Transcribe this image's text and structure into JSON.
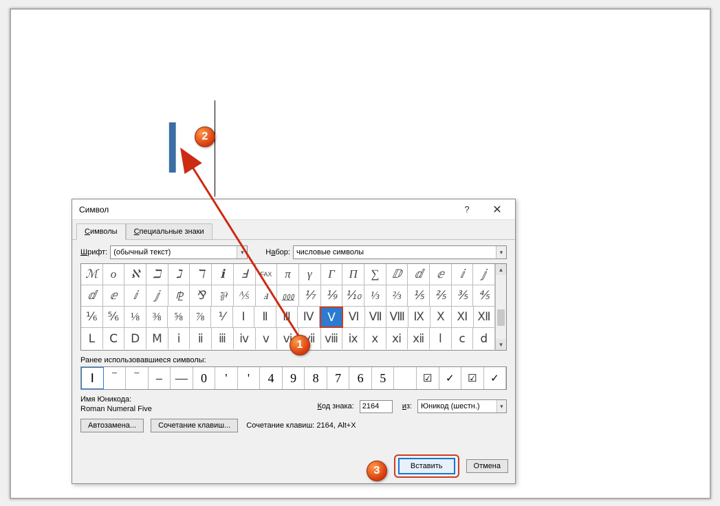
{
  "document": {
    "inserted_char": "Ⅰ"
  },
  "dialog": {
    "title": "Символ",
    "help": "?",
    "tabs": {
      "symbols_pre": "С",
      "symbols": "имволы",
      "special_pre": "С",
      "special": "пециальные знаки"
    },
    "font_label_pre": "Ш",
    "font_label": "рифт:",
    "font_value": "(обычный текст)",
    "subset_label_pre": "Н",
    "subset_label_mid": "а",
    "subset_label": "бор:",
    "subset_value": "числовые символы",
    "grid": {
      "row1": [
        "ℳ",
        "o",
        "ℵ",
        "ℶ",
        "ℷ",
        "ℸ",
        "ℹ",
        "Ⅎ",
        "FAX",
        "π",
        "γ",
        "Γ",
        "Π",
        "∑",
        "ⅅ",
        "ⅆ",
        "ⅇ",
        "ⅈ",
        "ⅉ"
      ],
      "row2": [
        "ⅆ",
        "ⅇ",
        "ⅈ",
        "ⅉ",
        "⅊",
        "⅋",
        "⅌",
        "⅍",
        "ⅎ",
        "⅏",
        "⅐",
        "⅑",
        "⅒",
        "⅓",
        "⅔",
        "⅕",
        "⅖",
        "⅗",
        "⅘"
      ],
      "row3": [
        "⅙",
        "⅚",
        "⅛",
        "⅜",
        "⅝",
        "⅞",
        "⅟",
        "Ⅰ",
        "Ⅱ",
        "Ⅲ",
        "Ⅳ",
        "Ⅴ",
        "Ⅵ",
        "Ⅶ",
        "Ⅷ",
        "Ⅸ",
        "Ⅹ",
        "Ⅺ",
        "Ⅻ"
      ],
      "row4": [
        "Ⅼ",
        "Ⅽ",
        "Ⅾ",
        "Ⅿ",
        "ⅰ",
        "ⅱ",
        "ⅲ",
        "ⅳ",
        "ⅴ",
        "ⅵ",
        "ⅶ",
        "ⅷ",
        "ⅸ",
        "ⅹ",
        "ⅺ",
        "ⅻ",
        "ⅼ",
        "ⅽ",
        "ⅾ"
      ],
      "selected_index": 11
    },
    "recent_label": "Ранее использовавшиеся символы:",
    "recent": [
      "Ⅰ",
      "‾",
      "‾",
      "–",
      "—",
      "0",
      "'",
      "'",
      "4",
      "9",
      "8",
      "7",
      "6",
      "5",
      "",
      "☑",
      "✓",
      "☑",
      "✓"
    ],
    "unicode_label": "Имя Юникода:",
    "unicode_name": "Roman Numeral Five",
    "code_label_pre": "К",
    "code_label": "од знака:",
    "code_value": "2164",
    "from_label_pre": "и",
    "from_label": "з:",
    "from_value": "Юникод (шестн.)",
    "autocorrect_pre": "А",
    "autocorrect": "втозамена...",
    "shortcut_btn": "Сочетани",
    "shortcut_btn_ul": "е",
    "shortcut_btn_post": " клавиш...",
    "shortcut_text": "Сочетание клавиш: 2164, Alt+X",
    "insert_pre": "Вст",
    "insert_ul": "а",
    "insert_post": "вить",
    "cancel": "Отмена"
  },
  "callouts": {
    "c1": "1",
    "c2": "2",
    "c3": "3"
  }
}
